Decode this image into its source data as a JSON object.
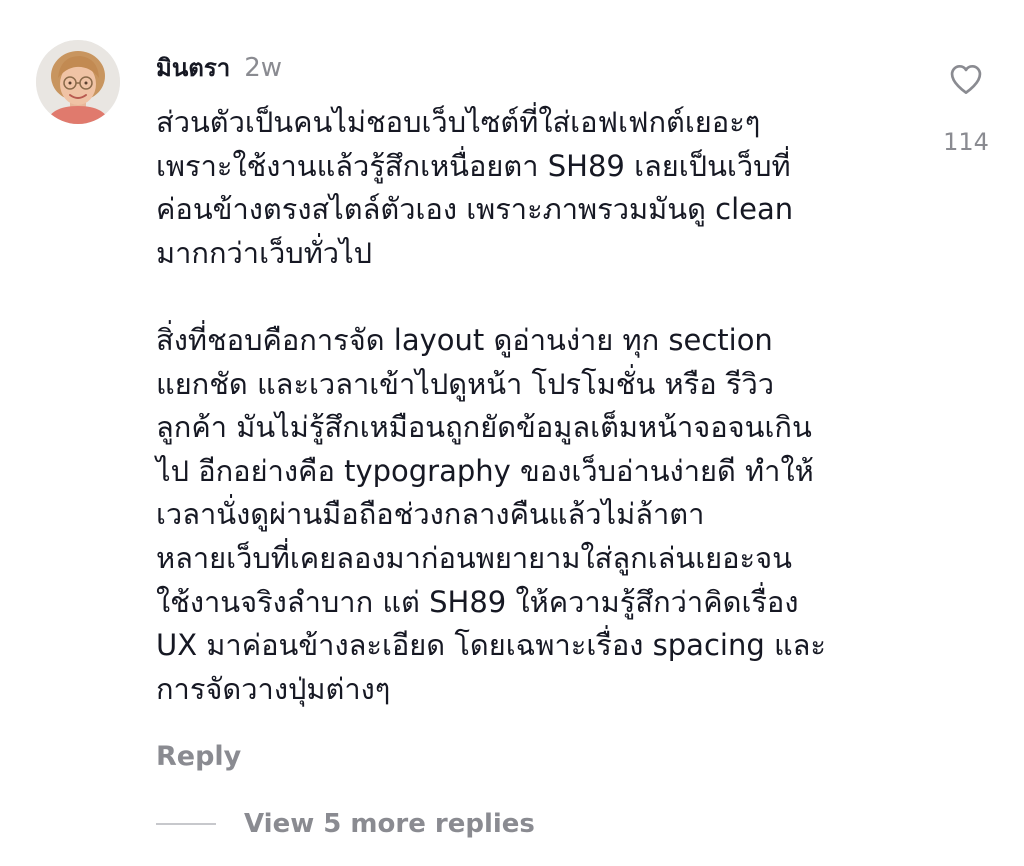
{
  "comment": {
    "username": "มินตรา",
    "timestamp": "2w",
    "paragraphs": [
      "ส่วนตัวเป็นคนไม่ชอบเว็บไซต์ที่ใส่เอฟเฟกต์เยอะๆ\nเพราะใช้งานแล้วรู้สึกเหนื่อยตา SH89 เลยเป็นเว็บที่\nค่อนข้างตรงสไตล์ตัวเอง เพราะภาพรวมมันดู clean\nมากกว่าเว็บทั่วไป",
      "สิ่งที่ชอบคือการจัด layout ดูอ่านง่าย ทุก section\nแยกชัด และเวลาเข้าไปดูหน้า โปรโมชั่น หรือ รีวิว\nลูกค้า มันไม่รู้สึกเหมือนถูกยัดข้อมูลเต็มหน้าจอจนเกิน\nไป อีกอย่างคือ typography ของเว็บอ่านง่ายดี ทำให้\nเวลานั่งดูผ่านมือถือช่วงกลางคืนแล้วไม่ล้าตา\nหลายเว็บที่เคยลองมาก่อนพยายามใส่ลูกเล่นเยอะจน\nใช้งานจริงลำบาก แต่ SH89 ให้ความรู้สึกว่าคิดเรื่อง\nUX มาค่อนข้างละเอียด โดยเฉพาะเรื่อง spacing และ\nการจัดวางปุ่มต่างๆ"
    ],
    "like_count": "114",
    "like_icon": "heart-outline-icon",
    "reply_label": "Reply",
    "view_replies_label": "View 5 more replies"
  },
  "colors": {
    "text_primary": "#161823",
    "text_secondary": "#8a8b91",
    "divider": "#c7c8cc"
  }
}
